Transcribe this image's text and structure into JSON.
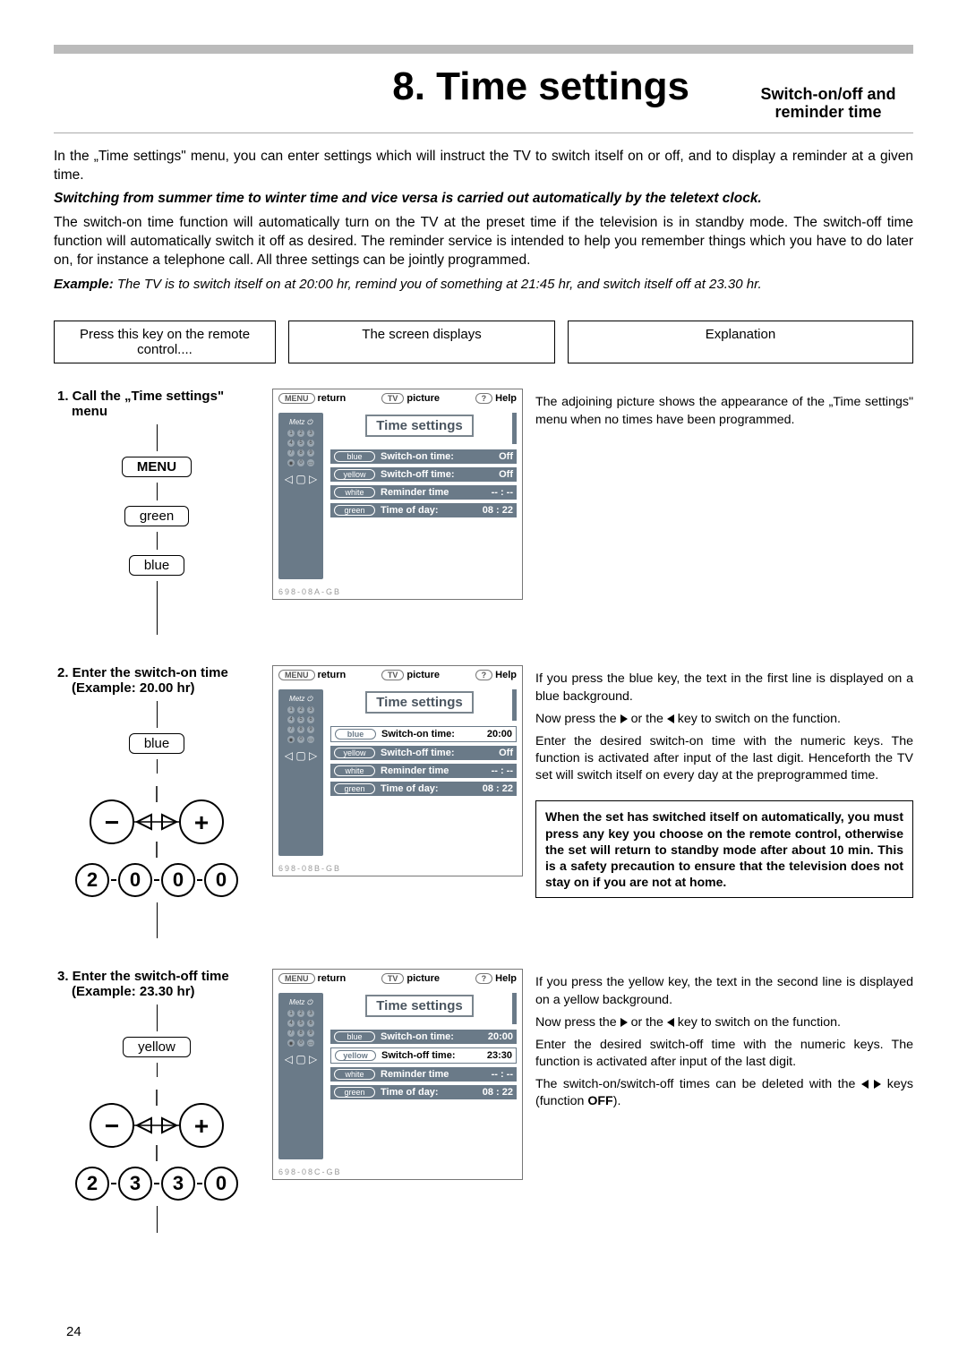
{
  "header": {
    "title": "8. Time settings",
    "subtitle_l1": "Switch-on/off and",
    "subtitle_l2": "reminder time"
  },
  "intro": {
    "p1": "In the „Time settings\" menu, you can enter settings which will instruct the TV to switch itself on or off, and to display a reminder at a given time.",
    "p2": "Switching from summer time to winter time and vice versa is carried out automatically by the teletext clock.",
    "p3": "The switch-on time function will automatically turn on the TV at the preset time if the television is in standby mode. The switch-off time function will automatically switch it off as desired. The reminder service is intended to help you remember things which you have to do later on, for instance a telephone call. All three settings can be jointly programmed.",
    "example_label": "Example:",
    "example_text": " The TV is to switch itself on at 20:00 hr, remind you of something at 21:45 hr, and switch itself off at 23.30 hr."
  },
  "columns": {
    "c1": "Press this key on the remote control....",
    "c2": "The screen displays",
    "c3": "Explanation"
  },
  "keys": {
    "menu": "MENU",
    "green": "green",
    "blue": "blue",
    "yellow": "yellow"
  },
  "tv_common": {
    "return": "return",
    "picture": "picture",
    "help": "Help",
    "menu_pill": "MENU",
    "tv_pill": "TV",
    "q_pill": "?",
    "title": "Time settings",
    "row_on": "Switch-on time:",
    "row_off": "Switch-off time:",
    "row_rem": "Reminder time",
    "row_tod": "Time of day:",
    "btn_blue": "blue",
    "btn_yellow": "yellow",
    "btn_white": "white",
    "btn_green": "green",
    "val_off": "Off",
    "val_dashes": "-- : --",
    "tod": "08 : 22"
  },
  "screens": {
    "a": {
      "on": "Off",
      "off": "Off",
      "code": "698-08A-GB",
      "sel": ""
    },
    "b": {
      "on": "20:00",
      "off": "Off",
      "code": "698-08B-GB",
      "sel": "on"
    },
    "c": {
      "on": "20:00",
      "off": "23:30",
      "code": "698-08C-GB",
      "sel": "off"
    }
  },
  "steps": {
    "s1": {
      "title": "1. Call the „Time settings\" menu",
      "expl": "The adjoining picture shows the appearance of the „Time settings\" menu when no times have been programmed."
    },
    "s2": {
      "title": "2. Enter the switch-on time",
      "sub": "(Example: 20.00 hr)",
      "digits": [
        "2",
        "0",
        "0",
        "0"
      ],
      "expl1": "If you press the blue key, the text in the first line is displayed on a blue background.",
      "expl2a": "Now press the ",
      "expl2b": " or the ",
      "expl2c": " key to switch on the function.",
      "expl3": "Enter the desired switch-on time with the numeric keys. The function is activated after input of the last digit. Henceforth the TV set will switch itself on every day at the preprogrammed time.",
      "note": "When the set has switched itself on automatically, you must press any key you choose on the remote control, otherwise the set will return to standby mode after about 10 min. This is a safety precaution to ensure that the television does not stay on if you are not at home."
    },
    "s3": {
      "title": "3. Enter the switch-off time",
      "sub": "(Example: 23.30 hr)",
      "digits": [
        "2",
        "3",
        "3",
        "0"
      ],
      "expl1": "If you press the yellow key, the text in the second line is displayed on a yellow background.",
      "expl2a": "Now press the ",
      "expl2b": " or the ",
      "expl2c": " key to switch on the function.",
      "expl3": "Enter the desired switch-off time with the numeric keys. The function is activated after input of the last digit.",
      "expl4a": "The switch-on/switch-off times can be deleted with the ",
      "expl4b": " keys (function ",
      "expl4c": "OFF",
      "expl4d": ")."
    }
  },
  "page_number": "24"
}
